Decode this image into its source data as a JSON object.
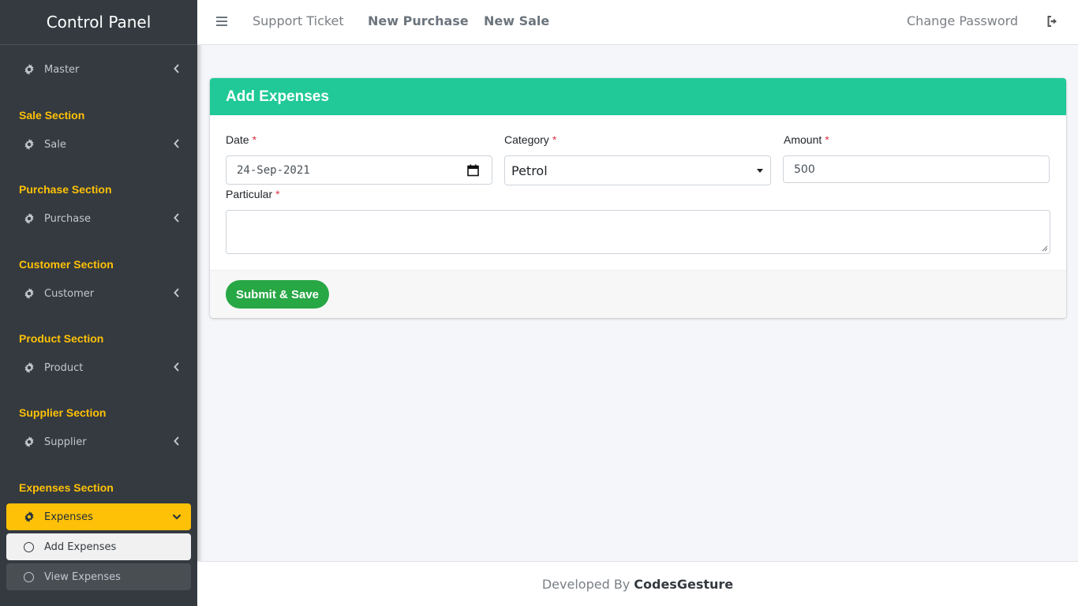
{
  "sidebar": {
    "brand": "Control Panel",
    "master": "Master",
    "sections": [
      {
        "header": "Sale Section",
        "item": "Sale"
      },
      {
        "header": "Purchase Section",
        "item": "Purchase"
      },
      {
        "header": "Customer Section",
        "item": "Customer"
      },
      {
        "header": "Product Section",
        "item": "Product"
      },
      {
        "header": "Supplier Section",
        "item": "Supplier"
      },
      {
        "header": "Expenses Section",
        "item": "Expenses"
      }
    ],
    "submenu": [
      "Add Expenses",
      "View Expenses"
    ]
  },
  "topbar": {
    "links": [
      "Support Ticket",
      "New Purchase",
      "New Sale"
    ],
    "change_password": "Change Password"
  },
  "form": {
    "title": "Add Expenses",
    "date_label": "Date",
    "date_value": "24-Sep-2021",
    "category_label": "Category",
    "category_value": "Petrol",
    "amount_label": "Amount",
    "amount_value": "500",
    "particular_label": "Particular",
    "particular_value": "",
    "required_mark": "*",
    "submit_label": "Submit & Save"
  },
  "footer": {
    "prefix": "Developed By",
    "brand": "CodesGesture"
  },
  "colors": {
    "sidebar_bg": "#343a40",
    "accent_yellow": "#ffc107",
    "header_teal": "#20c997",
    "submit_green": "#28a745"
  }
}
